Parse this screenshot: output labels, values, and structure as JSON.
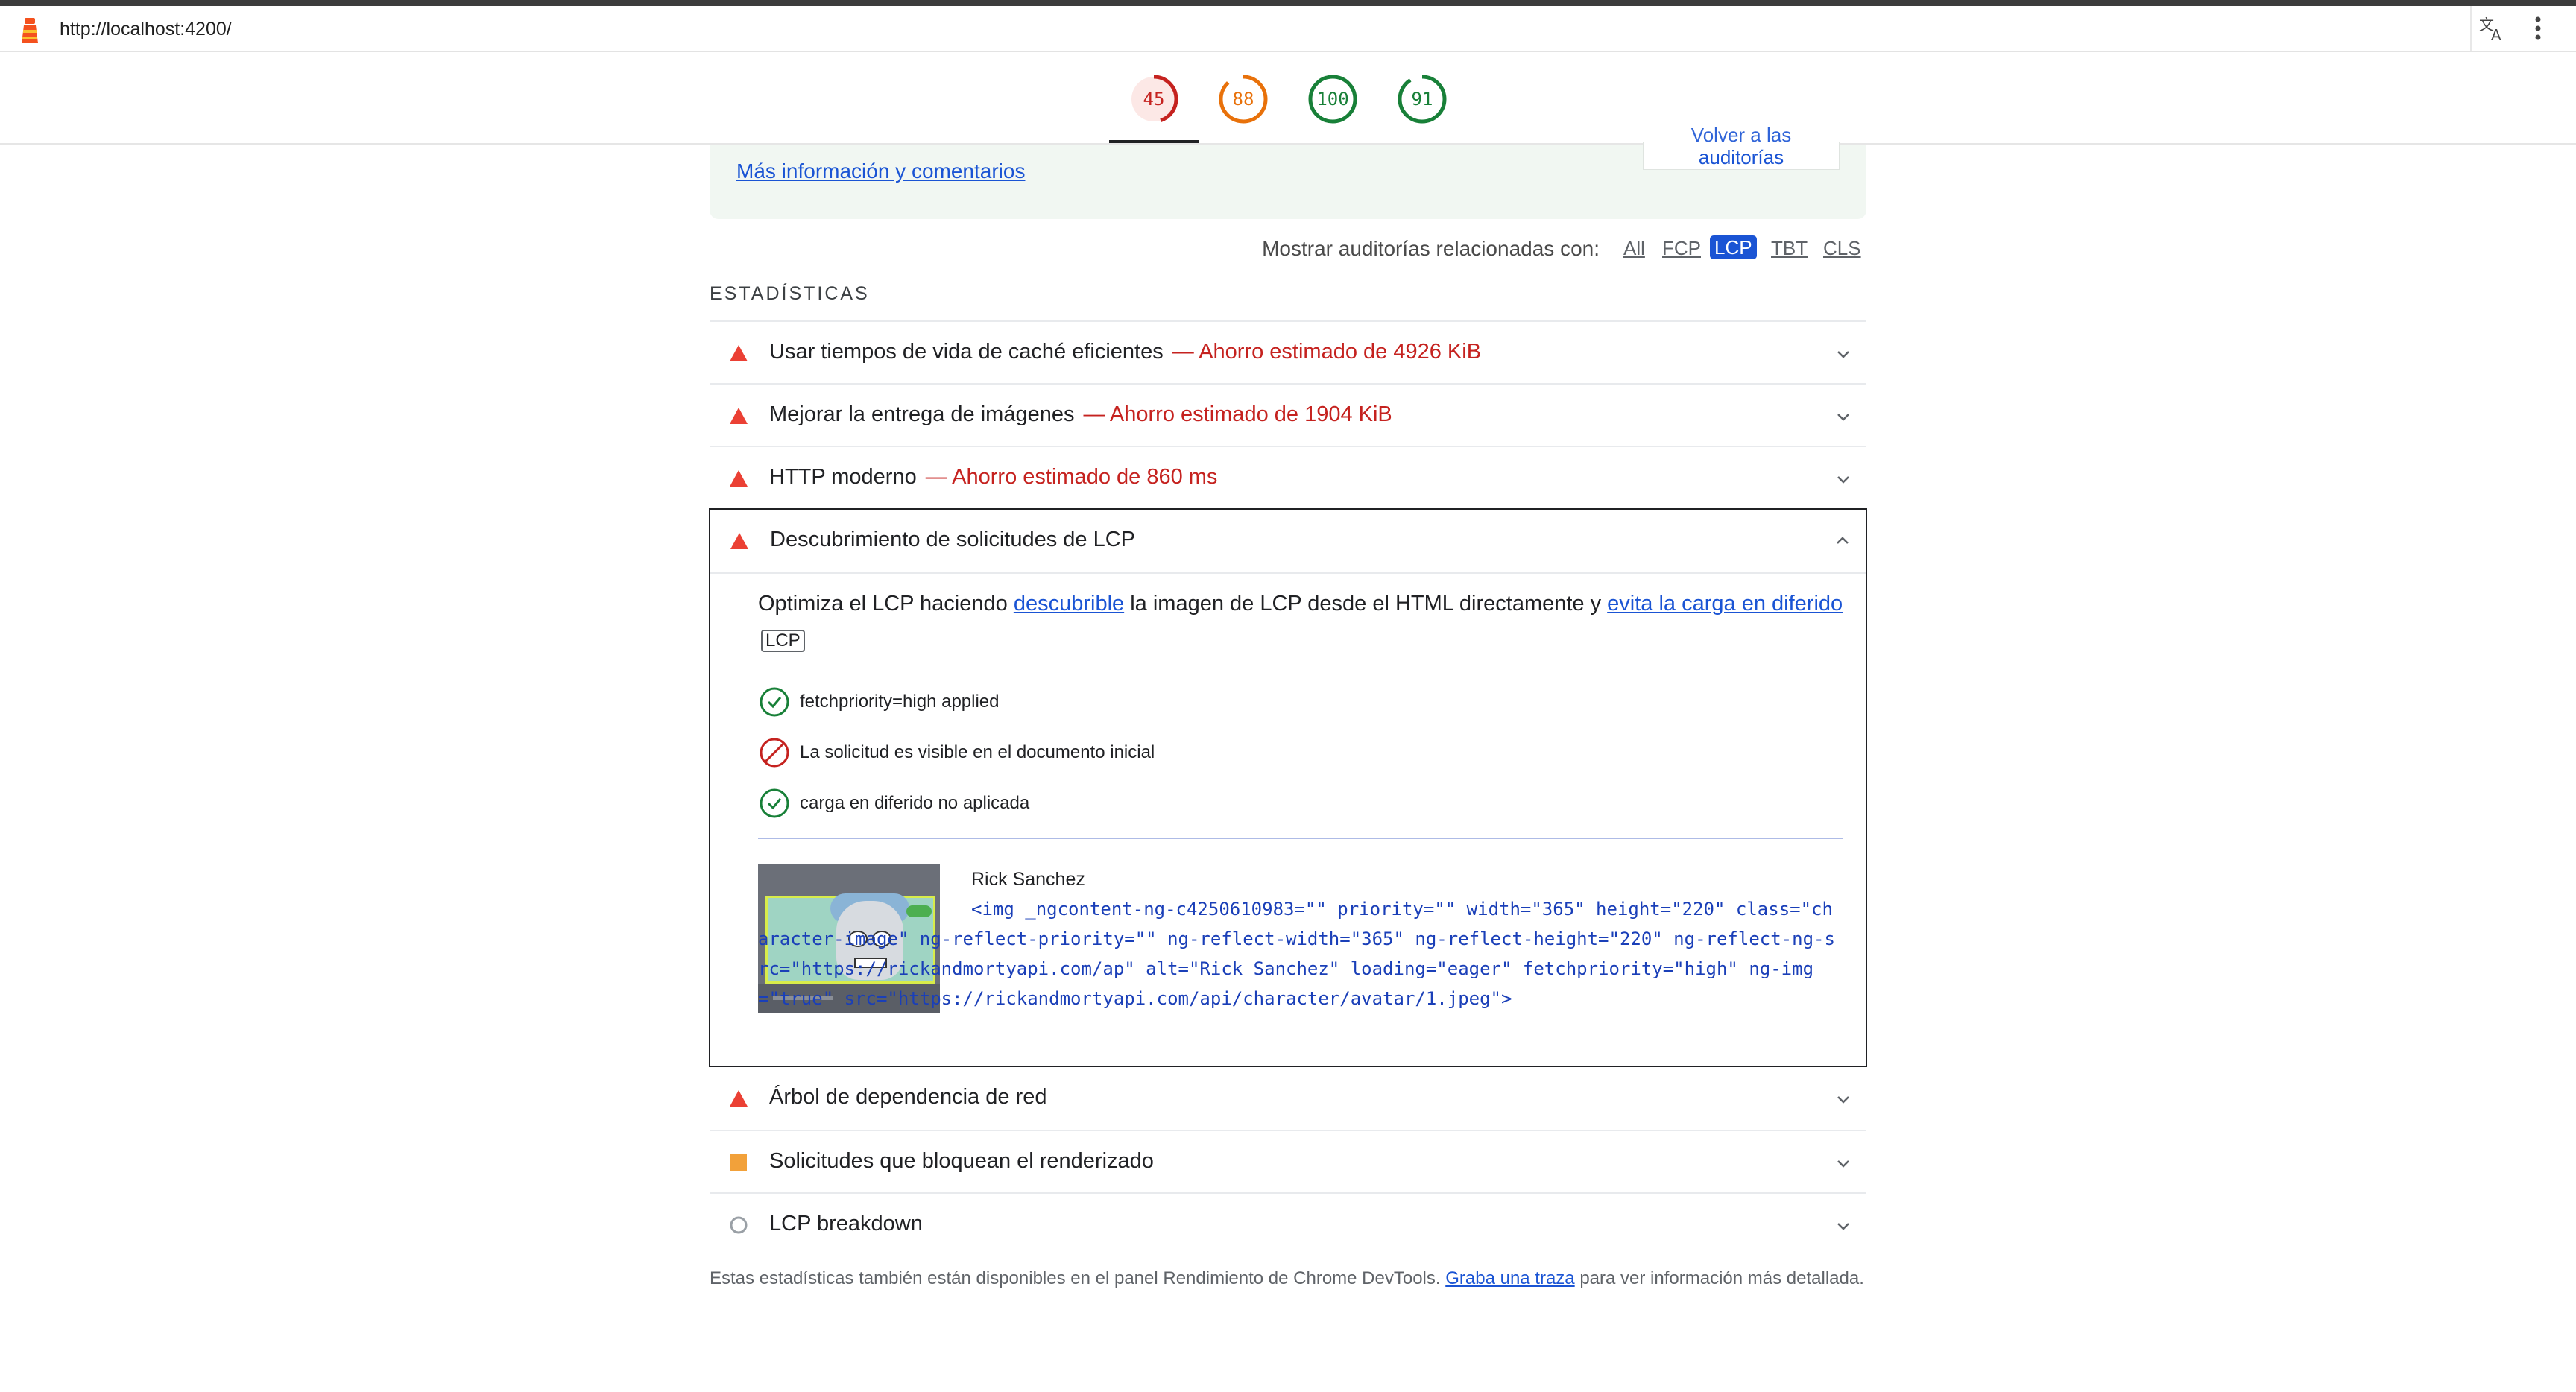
{
  "browser": {
    "url": "http://localhost:4200/"
  },
  "gauges": [
    {
      "label": "45",
      "value": 45,
      "color": "#c5221f",
      "bg": "#fce8e6"
    },
    {
      "label": "88",
      "value": 88,
      "color": "#e8710a",
      "bg": "#ffffff"
    },
    {
      "label": "100",
      "value": 100,
      "color": "#188038",
      "bg": "#ffffff"
    },
    {
      "label": "91",
      "value": 91,
      "color": "#188038",
      "bg": "#ffffff"
    }
  ],
  "feedback": {
    "link": "Más información y comentarios",
    "back_button": "auditorías",
    "back_button_partial": "Volver a las"
  },
  "filter": {
    "label": "Mostrar auditorías relacionadas con:",
    "options": [
      "All",
      "FCP",
      "LCP",
      "TBT",
      "CLS"
    ],
    "active": "LCP"
  },
  "section_title": "ESTADÍSTICAS",
  "audits": [
    {
      "title": "Usar tiempos de vida de caché eficientes",
      "savings": "— Ahorro estimado de 4926 KiB",
      "status": "fail"
    },
    {
      "title": "Mejorar la entrega de imágenes",
      "savings": "— Ahorro estimado de 1904 KiB",
      "status": "fail"
    },
    {
      "title": "HTTP moderno",
      "savings": "— Ahorro estimado de 860 ms",
      "status": "fail"
    }
  ],
  "expanded_audit": {
    "title": "Descubrimiento de solicitudes de LCP",
    "desc_part1": "Optimiza el LCP haciendo",
    "desc_link1": "descubrible",
    "desc_part2": "la imagen de LCP desde el HTML directamente y",
    "desc_link2": "evita la carga en diferido",
    "tag": "LCP",
    "checks": [
      {
        "label": "fetchpriority=high applied",
        "status": "pass"
      },
      {
        "label": "La solicitud es visible en el documento inicial",
        "status": "fail"
      },
      {
        "label": "carga en diferido no aplicada",
        "status": "pass"
      }
    ],
    "node_name": "Rick Sanchez",
    "snippet": "<img _ngcontent-ng-c4250610983=\"\" priority=\"\" width=\"365\" height=\"220\" class=\"character-image\" ng-reflect-priority=\"\" ng-reflect-width=\"365\" ng-reflect-height=\"220\" ng-reflect-ng-src=\"https://rickandmortyapi.com/ap\" alt=\"Rick Sanchez\" loading=\"eager\" fetchpriority=\"high\" ng-img=\"true\" src=\"https://rickandmortyapi.com/api/character/avatar/1.jpeg\">"
  },
  "audits_after": [
    {
      "title": "Árbol de dependencia de red",
      "status": "fail"
    },
    {
      "title": "Solicitudes que bloquean el renderizado",
      "status": "average"
    },
    {
      "title": "LCP breakdown",
      "status": "info"
    }
  ],
  "footer": {
    "text1": "Estas estadísticas también están disponibles en el panel Rendimiento de Chrome DevTools.",
    "link": "Graba una traza",
    "text2": "para ver información más detallada."
  }
}
